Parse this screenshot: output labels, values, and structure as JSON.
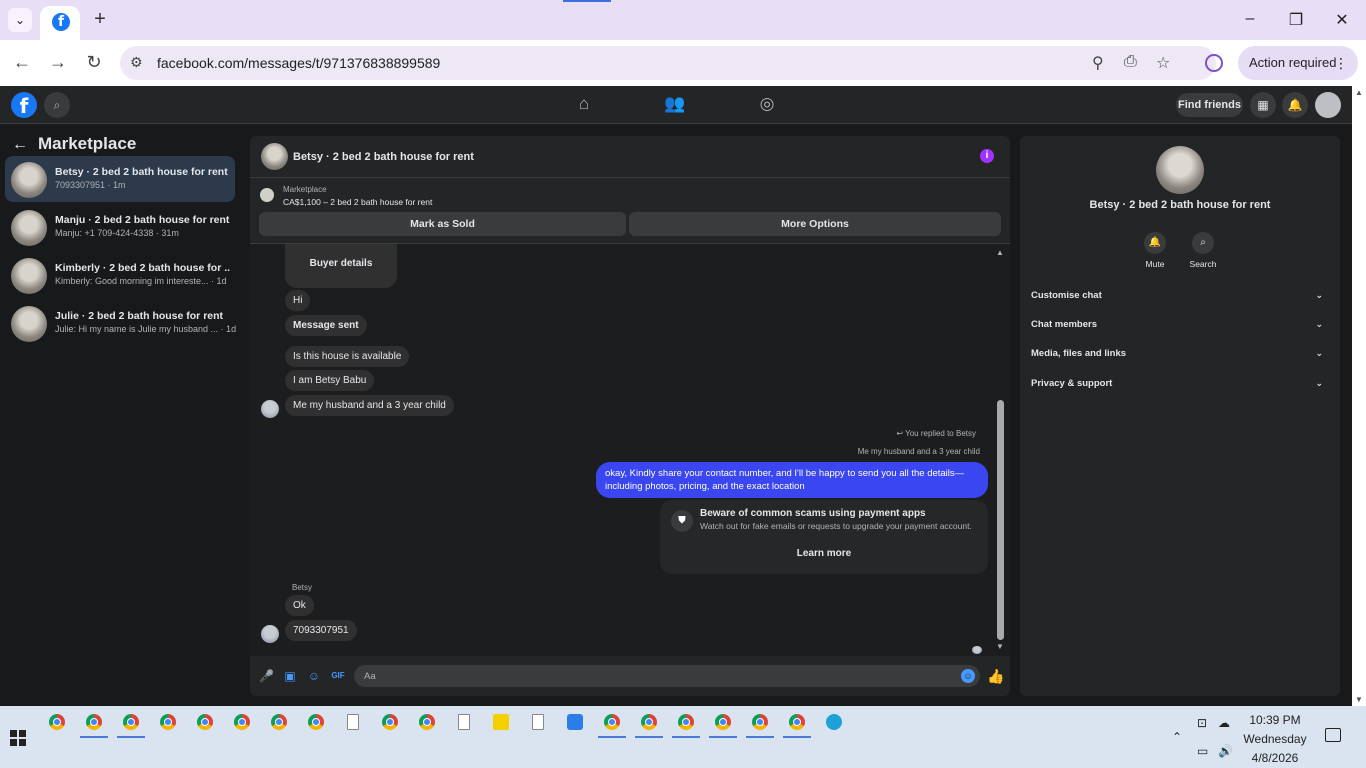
{
  "browser": {
    "url": "facebook.com/messages/t/971376838899589",
    "action_required": "Action required"
  },
  "fb_header": {
    "find_friends": "Find friends"
  },
  "sidebar": {
    "title": "Marketplace",
    "conversations": [
      {
        "name": "Betsy · 2 bed 2 bath house for rent",
        "preview": "7093307951 · 1m"
      },
      {
        "name": "Manju · 2 bed 2 bath house for rent",
        "preview": "Manju: +1 709-424-4338 · 31m"
      },
      {
        "name": "Kimberly · 2 bed 2 bath house for ...",
        "preview": "Kimberly: Good morning im intereste... · 1d"
      },
      {
        "name": "Julie · 2 bed 2 bath house for rent",
        "preview": "Julie: Hi my name is Julie my husband ... · 1d"
      }
    ]
  },
  "chat": {
    "title": "Betsy · 2 bed 2 bath house for rent",
    "marketplace_label": "Marketplace",
    "listing": "CA$1,100 – 2 bed 2 bath house for rent",
    "mark_sold": "Mark as Sold",
    "more_options": "More Options",
    "messages": {
      "buyer_details": "Buyer details",
      "hi": "Hi",
      "message_sent": "Message sent",
      "available": "Is this house is available",
      "iam": "I  am Betsy Babu",
      "family": "Me my husband and a 3 year child",
      "replied_to": "You replied to Betsy",
      "reply_quote": "Me my husband and a 3 year child",
      "outgoing": "okay,  Kindly share your contact number, and I'll be happy to send you all the details—including photos, pricing, and the exact location",
      "sender_label": "Betsy",
      "ok": "Ok",
      "number": "7093307951"
    },
    "scam_notice": {
      "title": "Beware of common scams using payment apps",
      "body": "Watch out for fake emails or requests to upgrade your payment account.",
      "link": "Learn more"
    },
    "composer_placeholder": "Aa"
  },
  "right_panel": {
    "name": "Betsy · 2 bed 2 bath house for rent",
    "mute": "Mute",
    "search": "Search",
    "sections": [
      "Customise chat",
      "Chat members",
      "Media, files and links",
      "Privacy & support"
    ]
  },
  "taskbar": {
    "time": "10:39 PM",
    "day": "Wednesday",
    "date": "4/8/2026"
  }
}
